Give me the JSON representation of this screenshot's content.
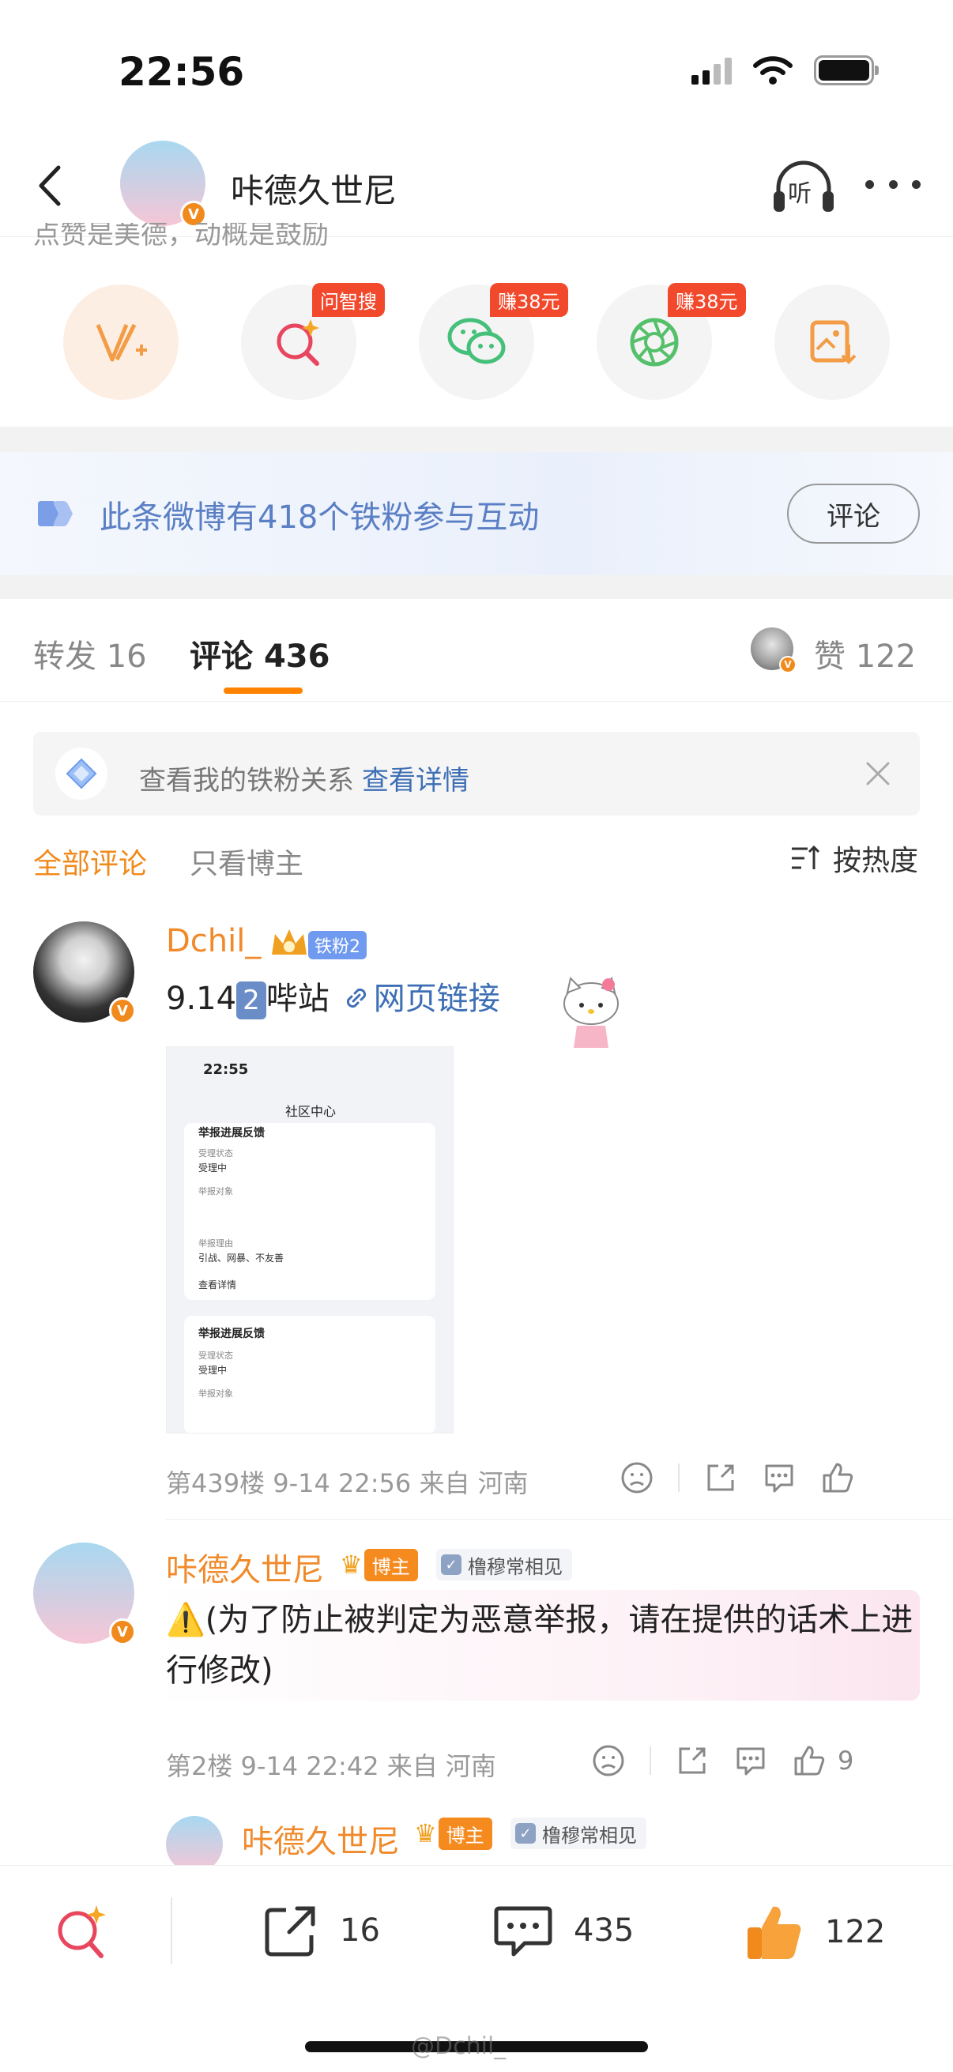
{
  "status_bar": {
    "time": "22:56"
  },
  "header": {
    "title": "咔德久世尼",
    "listen_label": "听"
  },
  "post_cut_text": "点赞是美德，动概是鼓励",
  "action_row": {
    "items": [
      {
        "name": "v-plus",
        "tag": ""
      },
      {
        "name": "ask-search",
        "tag": "问智搜"
      },
      {
        "name": "wechat",
        "tag": "赚38元"
      },
      {
        "name": "moments",
        "tag": "赚38元"
      },
      {
        "name": "save-image",
        "tag": ""
      }
    ]
  },
  "fan_banner": {
    "text": "此条微博有418个铁粉参与互动",
    "button": "评论"
  },
  "tabs": {
    "repost_label": "转发",
    "repost_count": "16",
    "comment_label": "评论",
    "comment_count": "436",
    "like_label": "赞",
    "like_count": "122"
  },
  "relation_bar": {
    "text": "查看我的铁粉关系",
    "link": "查看详情"
  },
  "filters": {
    "all": "全部评论",
    "owner_only": "只看博主",
    "sort": "按热度"
  },
  "comments": [
    {
      "user": "Dchil_",
      "fan_badge": "铁粉2",
      "text_prefix": "9.14",
      "text_box": "2",
      "text_after": "哔站",
      "link_text": "网页链接",
      "meta": "第439楼 9-14 22:56 来自 河南",
      "image": {
        "time": "22:55",
        "title": "社区中心",
        "card1_title": "举报进展反馈",
        "card1_status_label": "受理状态",
        "card1_status_value": "受理中",
        "card1_target_label": "举报对象",
        "card1_reason_label": "举报理由",
        "card1_reason_value": "引战、网暴、不友善",
        "card1_detail": "查看详情",
        "card2_title": "举报进展反馈",
        "card2_status_label": "受理状态",
        "card2_status_value": "受理中",
        "card2_target_label": "举报对象"
      }
    },
    {
      "user": "咔德久世尼",
      "owner_badge": "博主",
      "group_badge": "橹穆常相见",
      "text": "⚠️(为了防止被判定为恶意举报，请在提供的话术上进行修改)",
      "meta": "第2楼 9-14 22:42 来自 河南",
      "like_count": "9"
    },
    {
      "user": "咔德久世尼",
      "owner_badge": "博主",
      "group_badge": "橹穆常相见"
    }
  ],
  "bottom_bar": {
    "repost_count": "16",
    "comment_count": "435",
    "like_count": "122"
  },
  "watermark": "@Dchil_",
  "colors": {
    "accent": "#ff8200",
    "username": "#f08a2a",
    "link": "#3e6fb5"
  }
}
